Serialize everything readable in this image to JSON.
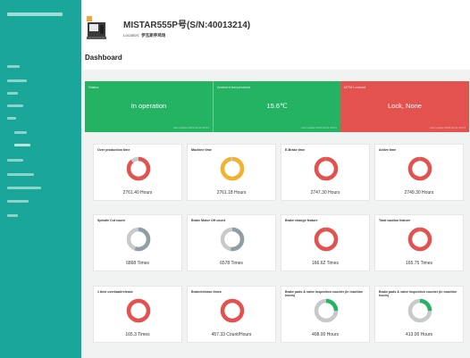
{
  "header": {
    "title": "MISTAR555P号(S/N:40013214)",
    "location_label": "Location:",
    "location_value": "伊瓦斯养鸡场",
    "dashboard_label": "Dashboard"
  },
  "status_boxes": [
    {
      "label": "Status",
      "value": "In operation",
      "color": "#23b363",
      "footer": "Last update 2023-01-01 09:31"
    },
    {
      "label": "Ambient temperature",
      "value": "15.6℃",
      "color": "#23b363",
      "footer": "Last update 2023-01-01 09:31"
    },
    {
      "label": "MTM Lockout",
      "value": "Lock, None",
      "color": "#e3524f",
      "footer": "Last update 2023-01-01 09:31"
    }
  ],
  "metrics": [
    {
      "label": "Over production time",
      "value": "2761.40 Hours",
      "fraction": 0.88,
      "color": "#e3524f"
    },
    {
      "label": "Machine time",
      "value": "2761.18 Hours",
      "fraction": 0.97,
      "color": "#f3b12c"
    },
    {
      "label": "E-Brake time",
      "value": "2747.30 Hours",
      "fraction": 0.99,
      "color": "#e3524f"
    },
    {
      "label": "Active time",
      "value": "2749.30 Hours",
      "fraction": 0.99,
      "color": "#e3524f"
    },
    {
      "label": "Spindle Cut count",
      "value": "6868 Times",
      "fraction": 0.55,
      "color": "#8f9da5"
    },
    {
      "label": "Brake Motor Off count",
      "value": "6578 Times",
      "fraction": 0.52,
      "color": "#8f9da5"
    },
    {
      "label": "Brake change feature",
      "value": "166.62 Times",
      "fraction": 0.99,
      "color": "#e3524f"
    },
    {
      "label": "Total caution feature",
      "value": "165.75 Times",
      "fraction": 0.99,
      "color": "#e3524f"
    },
    {
      "label": "1 time overload/release",
      "value": "165.3 Times",
      "fraction": 1.0,
      "color": "#e3524f"
    },
    {
      "label": "Brake/release times",
      "value": "457.33 Count/Hours",
      "fraction": 1.0,
      "color": "#e3524f"
    },
    {
      "label": "Brake pads & valve inspection counter (in machine hours)",
      "value": "408.00 Hours",
      "fraction": 0.25,
      "color": "#23b363"
    },
    {
      "label": "Brake pads & valve inspection counter (in machine hours)",
      "value": "413.00 Hours",
      "fraction": 0.25,
      "color": "#23b363"
    }
  ]
}
